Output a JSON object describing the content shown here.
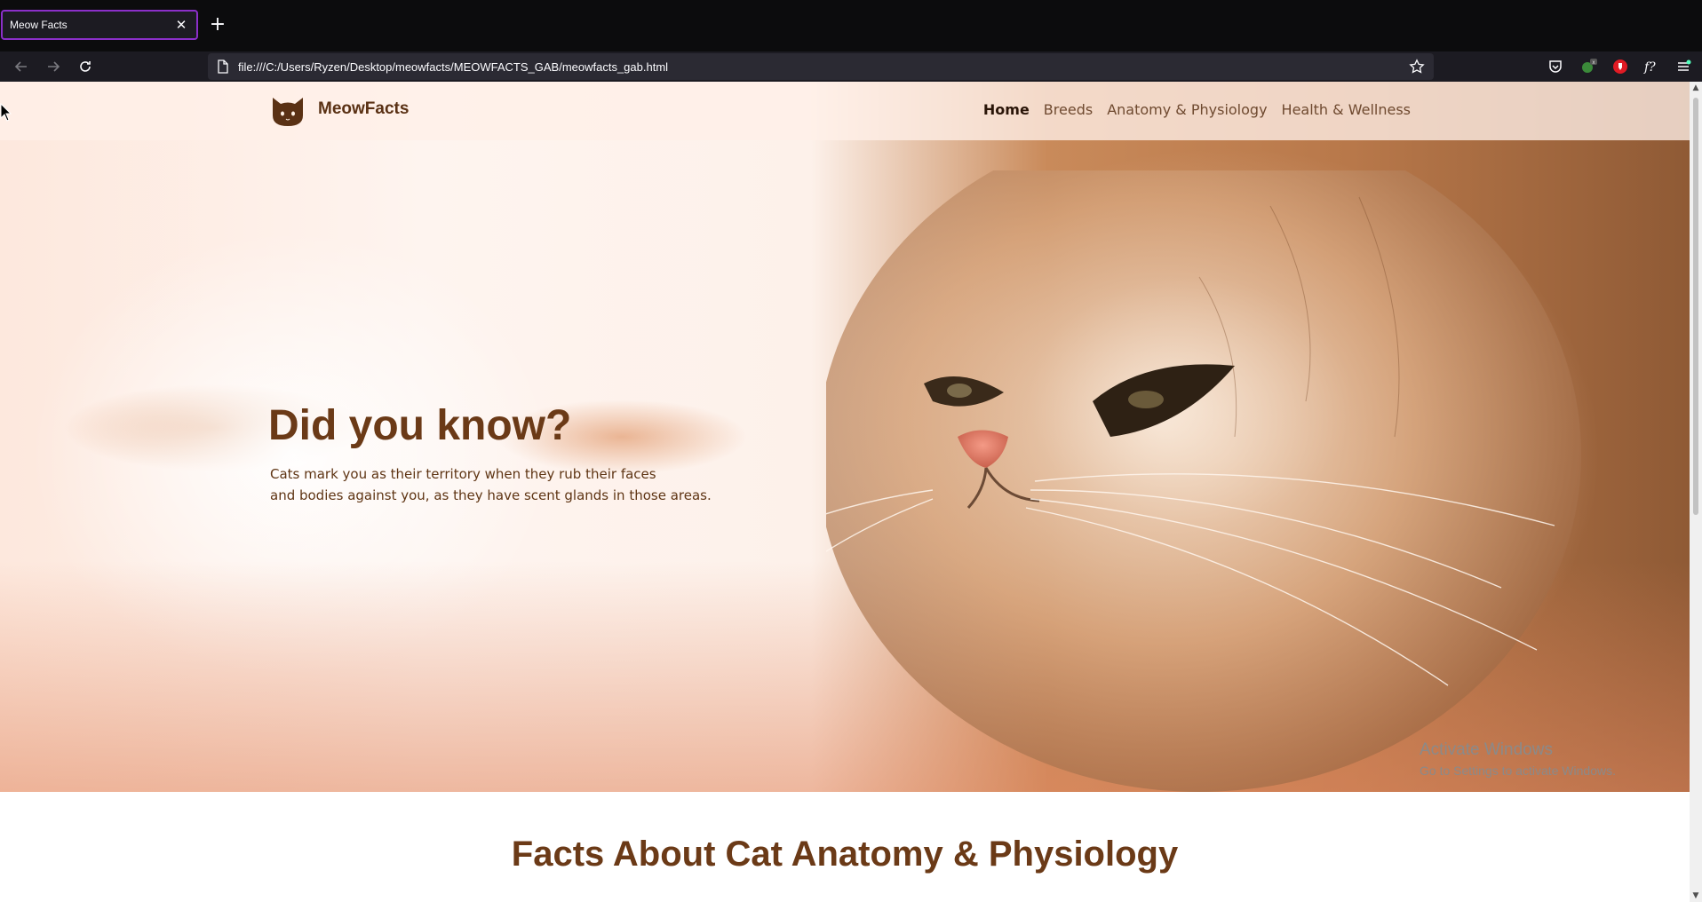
{
  "browser": {
    "tab_title": "Meow Facts",
    "tab_close": "✕",
    "new_tab": "+",
    "url": "file:///C:/Users/Ryzen/Desktop/meowfacts/MEOWFACTS_GAB/meowfacts_gab.html",
    "accent_color": "#8b2fc9"
  },
  "site": {
    "logo_text": "MeowFacts",
    "nav": [
      {
        "label": "Home",
        "active": true
      },
      {
        "label": "Breeds"
      },
      {
        "label": "Anatomy & Physiology"
      },
      {
        "label": "Health & Wellness"
      }
    ]
  },
  "hero": {
    "title": "Did you know?",
    "line1": "Cats mark you as their territory when they rub their faces",
    "line2": "and bodies against you, as they have scent glands in those areas."
  },
  "section": {
    "title": "Facts About Cat Anatomy & Physiology"
  },
  "overlay": {
    "activate_title": "Activate Windows",
    "activate_sub": "Go to Settings to activate Windows."
  },
  "colors": {
    "brand_brown": "#6b3a17",
    "nav_text": "#6f4a30"
  }
}
